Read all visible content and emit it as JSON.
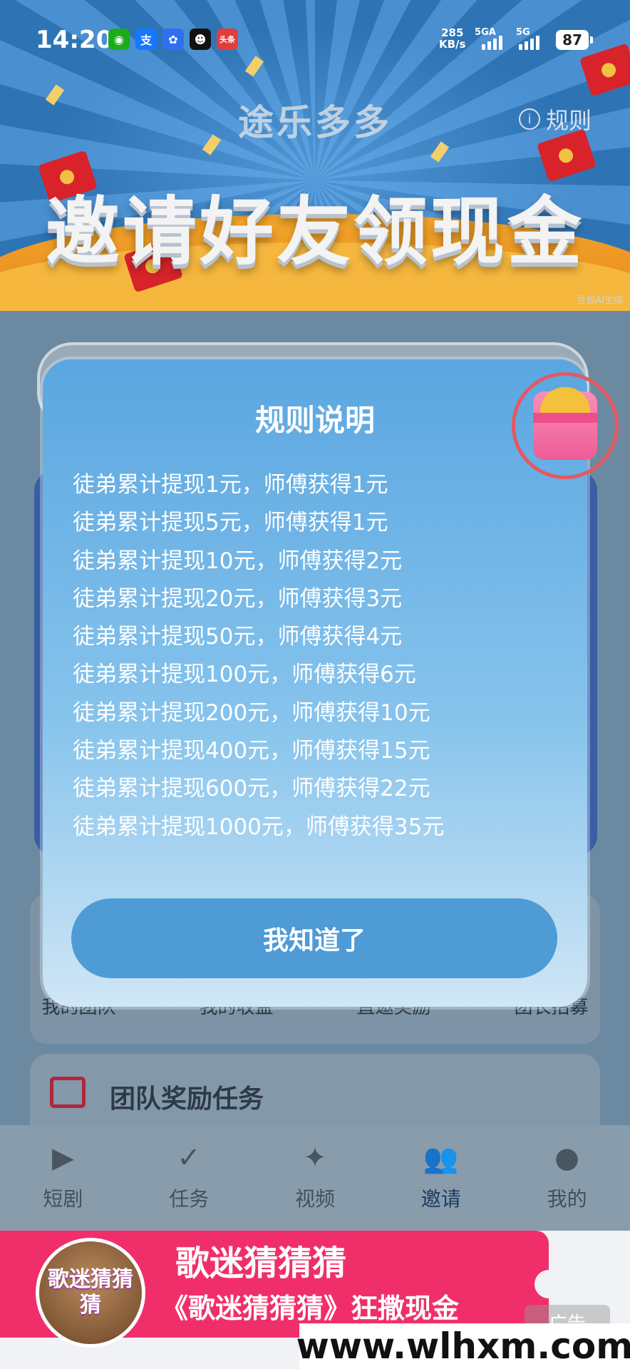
{
  "status_bar": {
    "time": "14:20",
    "apps": [
      {
        "icon": "wechat-icon",
        "glyph": "◉",
        "color": "#1aad19"
      },
      {
        "icon": "alipay-icon",
        "glyph": "支",
        "color": "#1677ff"
      },
      {
        "icon": "baidu-icon",
        "glyph": "✿",
        "color": "#2f6ff0"
      },
      {
        "icon": "qq-icon",
        "glyph": "☻",
        "color": "#111111"
      },
      {
        "icon": "toutiao-icon",
        "glyph": "头条",
        "color": "#e23c3c"
      }
    ],
    "net_speed": "285",
    "net_unit": "KB/s",
    "signal1": "5GA",
    "signal2": "5G",
    "battery": "87"
  },
  "hero": {
    "brand": "途乐多多",
    "rules_link": "规则",
    "title": "邀请好友领现金",
    "ai_mark": "豆包AI生成"
  },
  "background": {
    "tabs": [
      "我的团队",
      "我的收益",
      "直邀奖励",
      "团长招募"
    ],
    "team_task_title": "团队奖励任务"
  },
  "modal": {
    "title": "规则说明",
    "rules": [
      "徒弟累计提现1元，师傅获得1元",
      "徒弟累计提现5元，师傅获得1元",
      "徒弟累计提现10元，师傅获得2元",
      "徒弟累计提现20元，师傅获得3元",
      "徒弟累计提现50元，师傅获得4元",
      "徒弟累计提现100元，师傅获得6元",
      "徒弟累计提现200元，师傅获得10元",
      "徒弟累计提现400元，师傅获得15元",
      "徒弟累计提现600元，师傅获得22元",
      "徒弟累计提现1000元，师傅获得35元"
    ],
    "ok_button": "我知道了"
  },
  "bottom_nav": {
    "active_index": 3,
    "items": [
      {
        "label": "短剧",
        "icon": "video-camera-icon",
        "glyph": "▶"
      },
      {
        "label": "任务",
        "icon": "task-doc-icon",
        "glyph": "✓"
      },
      {
        "label": "视频",
        "icon": "clapper-icon",
        "glyph": "✦"
      },
      {
        "label": "邀请",
        "icon": "add-friend-icon",
        "glyph": "👥"
      },
      {
        "label": "我的",
        "icon": "user-icon",
        "glyph": "●"
      }
    ]
  },
  "ad": {
    "avatar_text": "歌迷猜猜猜",
    "title": "歌迷猜猜猜",
    "desc": "《歌迷猜猜猜》狂撒现金",
    "tag": "广告"
  },
  "watermark": "www.wlhxm.com"
}
